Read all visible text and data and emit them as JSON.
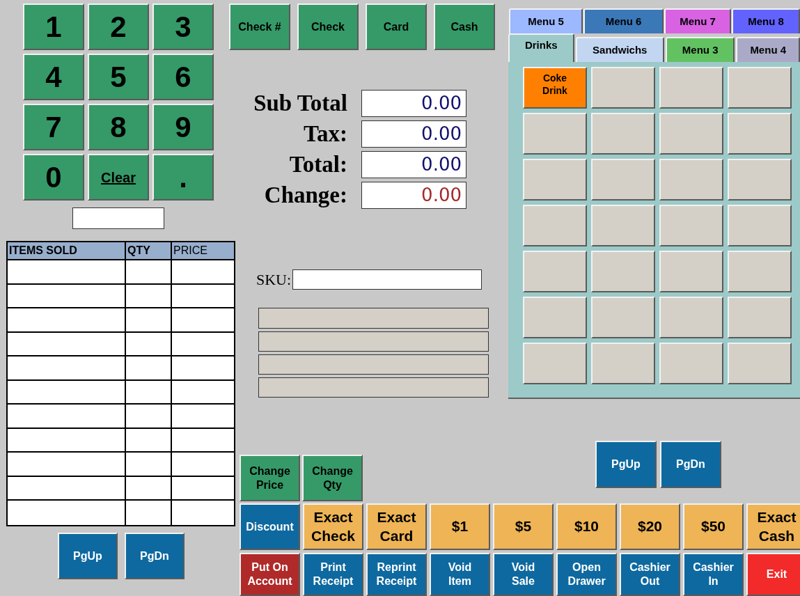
{
  "keypad": [
    {
      "label": "1",
      "kind": "digit"
    },
    {
      "label": "2",
      "kind": "digit"
    },
    {
      "label": "3",
      "kind": "digit"
    },
    {
      "label": "4",
      "kind": "digit"
    },
    {
      "label": "5",
      "kind": "digit"
    },
    {
      "label": "6",
      "kind": "digit"
    },
    {
      "label": "7",
      "kind": "digit"
    },
    {
      "label": "8",
      "kind": "digit"
    },
    {
      "label": "9",
      "kind": "digit"
    },
    {
      "label": "0",
      "kind": "digit"
    },
    {
      "label": "Clear",
      "kind": "word"
    },
    {
      "label": ".",
      "kind": "digit"
    }
  ],
  "tender_buttons": [
    {
      "label": "Check #",
      "color": "#359a68"
    },
    {
      "label": "Check",
      "color": "#359a68"
    },
    {
      "label": "Card",
      "color": "#359a68"
    },
    {
      "label": "Cash",
      "color": "#359a68"
    }
  ],
  "totals": [
    {
      "label": "Sub Total",
      "value": "0.00",
      "color": "#10106e"
    },
    {
      "label": "Tax:",
      "value": "0.00",
      "color": "#10106e"
    },
    {
      "label": "Total:",
      "value": "0.00",
      "color": "#10106e"
    },
    {
      "label": "Change:",
      "value": "0.00",
      "color": "#a32a2a"
    }
  ],
  "items_table": {
    "columns": [
      {
        "label": "ITEMS SOLD",
        "bold": true
      },
      {
        "label": "QTY",
        "bold": true
      },
      {
        "label": "PRICE",
        "bold": false
      }
    ]
  },
  "table_pager": [
    {
      "label": "PgUp",
      "color": "#0e69a0"
    },
    {
      "label": "PgDn",
      "color": "#0e69a0"
    }
  ],
  "sku": {
    "label": "SKU:"
  },
  "menu": {
    "tab_rows": [
      {
        "tabs": [
          {
            "label": "Menu 5",
            "color": "#9cb8ff",
            "selected": false
          },
          {
            "label": "Menu 6",
            "color": "#3a78b8",
            "selected": false
          },
          {
            "label": "Menu 7",
            "color": "#d862e2",
            "selected": false
          },
          {
            "label": "Menu 8",
            "color": "#6262ff",
            "selected": false
          }
        ]
      },
      {
        "tabs": [
          {
            "label": "Drinks",
            "color": "#9ccac8",
            "selected": true
          },
          {
            "label": "Sandwichs",
            "color": "#c2d6f2",
            "selected": false
          },
          {
            "label": "Menu 3",
            "color": "#62c262",
            "selected": false
          },
          {
            "label": "Menu 4",
            "color": "#aaaac8",
            "selected": false
          }
        ]
      }
    ],
    "items": [
      {
        "label": "Coke\nDrink",
        "color": "#ff8000"
      }
    ]
  },
  "menu_pager": [
    {
      "label": "PgUp",
      "color": "#0e69a0"
    },
    {
      "label": "PgDn",
      "color": "#0e69a0"
    }
  ],
  "edit_buttons": [
    {
      "label": "Change\nPrice",
      "color": "#359a68"
    },
    {
      "label": "Change\nQty",
      "color": "#359a68"
    }
  ],
  "quick_buttons": [
    {
      "label": "Discount",
      "color": "#0e69a0",
      "kind": "small"
    },
    {
      "label": "Exact\nCheck",
      "color": "#eeb455",
      "kind": "large"
    },
    {
      "label": "Exact\nCard",
      "color": "#eeb455",
      "kind": "large"
    },
    {
      "label": "$1",
      "color": "#eeb455",
      "kind": "large"
    },
    {
      "label": "$5",
      "color": "#eeb455",
      "kind": "large"
    },
    {
      "label": "$10",
      "color": "#eeb455",
      "kind": "large"
    },
    {
      "label": "$20",
      "color": "#eeb455",
      "kind": "large"
    },
    {
      "label": "$50",
      "color": "#eeb455",
      "kind": "large"
    },
    {
      "label": "Exact\nCash",
      "color": "#eeb455",
      "kind": "large"
    }
  ],
  "function_buttons": [
    {
      "label": "Put On\nAccount",
      "color": "#b02a2a"
    },
    {
      "label": "Print\nReceipt",
      "color": "#0e69a0"
    },
    {
      "label": "Reprint\nReceipt",
      "color": "#0e69a0"
    },
    {
      "label": "Void\nItem",
      "color": "#0e69a0"
    },
    {
      "label": "Void\nSale",
      "color": "#0e69a0"
    },
    {
      "label": "Open\nDrawer",
      "color": "#0e69a0"
    },
    {
      "label": "Cashier\nOut",
      "color": "#0e69a0"
    },
    {
      "label": "Cashier\nIn",
      "color": "#0e69a0"
    },
    {
      "label": "Exit",
      "color": "#f22a2a"
    }
  ]
}
